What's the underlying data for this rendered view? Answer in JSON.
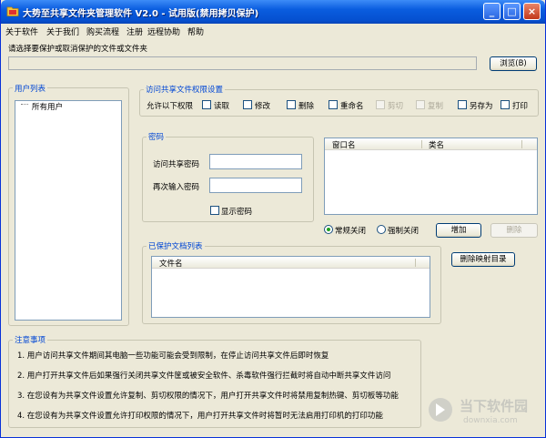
{
  "window": {
    "title": "大势至共享文件夹管理软件  V2.0  - 试用版(禁用拷贝保护)",
    "minimize_label": "_",
    "maximize_label": "□",
    "close_label": "×"
  },
  "menu": [
    "关于软件",
    "关于我们",
    "购买流程",
    "注册",
    "远程协助",
    "帮助"
  ],
  "path_section": {
    "prompt": "请选择要保护或取消保护的文件或文件夹",
    "path_value": "",
    "browse_label": "浏览(B)"
  },
  "users": {
    "title": "用户列表",
    "items": [
      "所有用户"
    ]
  },
  "permissions": {
    "title": "访问共享文件权限设置",
    "allow_label": "允许以下权限",
    "options": [
      {
        "label": "读取",
        "checked": false,
        "enabled": true
      },
      {
        "label": "修改",
        "checked": false,
        "enabled": true
      },
      {
        "label": "删除",
        "checked": false,
        "enabled": true
      },
      {
        "label": "重命名",
        "checked": false,
        "enabled": true
      },
      {
        "label": "剪切",
        "checked": false,
        "enabled": false
      },
      {
        "label": "复制",
        "checked": false,
        "enabled": false
      },
      {
        "label": "另存为",
        "checked": false,
        "enabled": true
      },
      {
        "label": "打印",
        "checked": false,
        "enabled": true
      }
    ]
  },
  "password": {
    "title": "密码",
    "access_label": "访问共享密码",
    "confirm_label": "再次输入密码",
    "access_value": "",
    "confirm_value": "",
    "show_label": "显示密码",
    "show_checked": false
  },
  "window_list": {
    "columns": [
      "窗口名",
      "类名"
    ],
    "rows": []
  },
  "close_mode": {
    "options": [
      {
        "label": "常规关闭",
        "selected": true
      },
      {
        "label": "强制关闭",
        "selected": false
      }
    ],
    "add_label": "增加",
    "delete_label": "删除",
    "delete_enabled": false
  },
  "protected_docs": {
    "title": "已保护文档列表",
    "column": "文件名",
    "rows": []
  },
  "delete_map_label": "删除映射目录",
  "notes": {
    "title": "注意事项",
    "items": [
      "1. 用户访问共享文件期间其电脑一些功能可能会受到限制，在停止访问共享文件后即时恢复",
      "2. 用户打开共享文件后如果强行关闭共享文件筐或被安全软件、杀毒软件强行拦截时将自动中断共享文件访问",
      "3. 在您设有为共享文件设置允许复制、剪切权限的情况下，用户打开共享文件时将禁用复制热键、剪切板等功能",
      "4. 在您设有为共享文件设置允许打印权限的情况下，用户打开共享文件时将暂时无法启用打印机的打印功能"
    ]
  },
  "watermark": {
    "name": "当下软件园",
    "url": "downxia.com"
  },
  "colors": {
    "title_bar": "#0a5ddf",
    "group_title": "#0046d5",
    "dialog_bg": "#ece9d8"
  }
}
